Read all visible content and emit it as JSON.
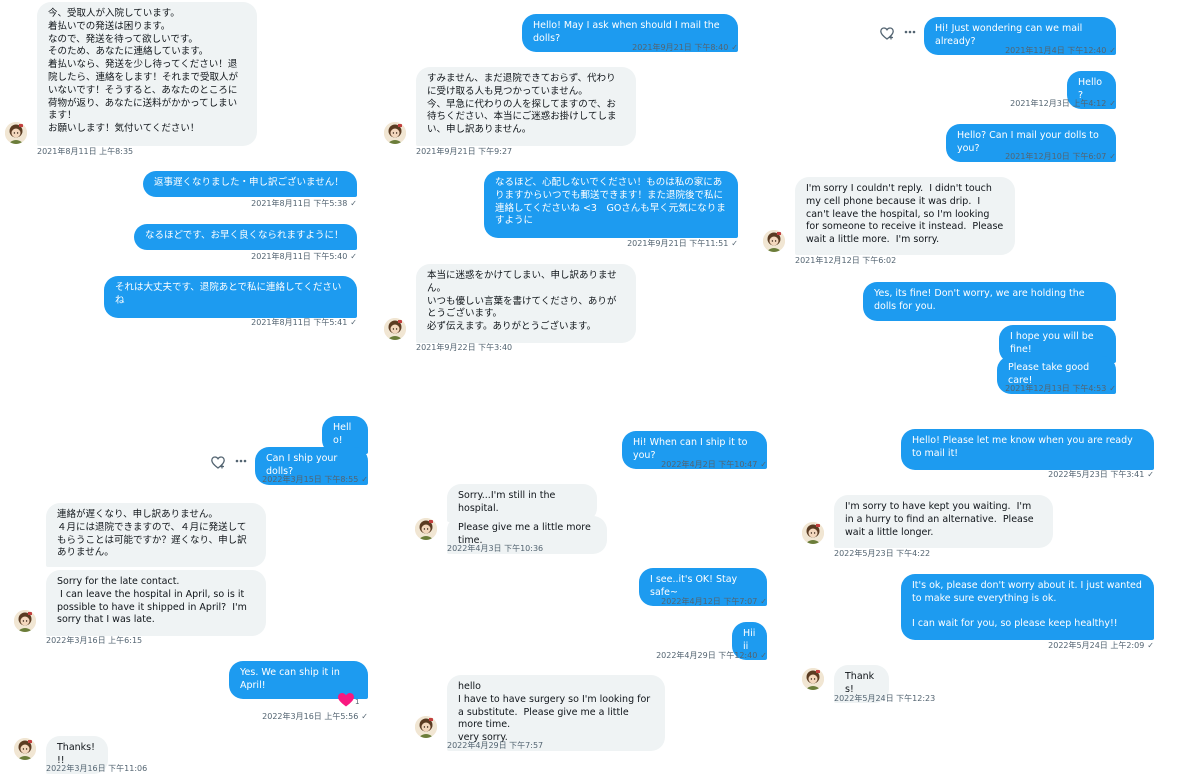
{
  "panels": [
    {
      "id": "p1",
      "messages": [
        {
          "side": "recv",
          "text": "今、受取人が入院しています。\n着払いでの発送は困ります。\nなので、発送を待って欲しいです。\nそのため、あなたに連絡しています。\n着払いなら、発送を少し待ってください！退院したら、連絡をします！それまで受取人がいないです！そうすると、あなたのところに荷物が返り、あなたに送料がかかってしまいます！\nお願いします！気付いてください！",
          "time": "2021年8月11日 上午8:35"
        },
        {
          "side": "sent",
          "text": "返事遅くなりました・申し訳ございません！",
          "time": "2021年8月11日 下午5:38"
        },
        {
          "side": "sent",
          "text": "なるほどです、お早く良くなられますように！",
          "time": "2021年8月11日 下午5:40"
        },
        {
          "side": "sent",
          "text": "それは大丈夫です、退院あとで私に連絡してください\nね",
          "time": "2021年8月11日 下午5:41"
        }
      ]
    },
    {
      "id": "p2",
      "messages": [
        {
          "side": "sent",
          "text": "Hello! May I ask when should I mail the dolls?",
          "time": "2021年9月21日 下午8:40"
        },
        {
          "side": "recv",
          "text": "すみません、まだ退院できておらず、代わりに受け取る人も見つかっていません。\n今、早急に代わりの人を探してますので、お待ちください、本当にご迷惑お掛けしてしまい、申し訳ありません。",
          "time": "2021年9月21日 下午9:27"
        },
        {
          "side": "sent",
          "text": "なるほど、心配しないでください！ものは私の家にありますからいつでも郵送できます！また退院後で私に連絡してくださいね <3　GOさんも早く元気になりますように",
          "time": "2021年9月21日 下午11:51"
        },
        {
          "side": "recv",
          "text": "本当に迷惑をかけてしまい、申し訳ありません。\nいつも優しい言葉を書けてくださり、ありがとうございます。\n必ず伝えます。ありがとうございます。",
          "time": "2021年9月22日 下午3:40"
        }
      ]
    },
    {
      "id": "p3",
      "messages": [
        {
          "side": "sent",
          "text": "Hi! Just wondering can we mail already?",
          "time": "2021年11月4日 下午12:40"
        },
        {
          "side": "sent",
          "text": "Hello?",
          "time": "2021年12月3日 上午4:12"
        },
        {
          "side": "sent",
          "text": "Hello? Can I mail your dolls to you?",
          "time": "2021年12月10日 下午6:07"
        },
        {
          "side": "recv",
          "text": "I'm sorry I couldn't reply.  I didn't touch my cell phone because it was drip.  I can't leave the hospital, so I'm looking for someone to receive it instead.  Please wait a little more.  I'm sorry.",
          "time": "2021年12月12日 下午6:02"
        },
        {
          "side": "sent",
          "text": "Yes, its fine! Don't worry, we are holding the dolls for you.",
          "time": ""
        },
        {
          "side": "sent",
          "text": "I hope you will be fine!",
          "time": ""
        },
        {
          "side": "sent",
          "text": "Please take good care!",
          "time": "2021年12月13日 下午4:53"
        }
      ]
    },
    {
      "id": "p4",
      "messages": [
        {
          "side": "sent",
          "text": "Hello!",
          "time": ""
        },
        {
          "side": "sent",
          "text": "Can I ship your dolls?",
          "time": "2022年3月15日 下午8:55"
        },
        {
          "side": "recv",
          "text": "連絡が遅くなり、申し訳ありません。\n４月には退院できますので、４月に発送してもらうことは可能ですか？遅くなり、申し訳ありません。",
          "time": ""
        },
        {
          "side": "recv",
          "text": "Sorry for the late contact.\n I can leave the hospital in April, so is it possible to have it shipped in April?  I'm sorry that I was late.",
          "time": "2022年3月16日 上午6:15"
        },
        {
          "side": "sent",
          "text": "Yes. We can ship it in April!",
          "time": "2022年3月16日 上午5:56"
        },
        {
          "side": "recv",
          "text": "Thanks!!!",
          "time": "2022年3月16日 下午11:06"
        }
      ],
      "reaction": {
        "emoji": "heart",
        "count": "1"
      }
    },
    {
      "id": "p5",
      "messages": [
        {
          "side": "sent",
          "text": "Hi! When can I ship it to you?",
          "time": "2022年4月2日 下午10:47"
        },
        {
          "side": "recv",
          "text": "Sorry...I'm still in the hospital.",
          "time": ""
        },
        {
          "side": "recv",
          "text": "Please give me a little more time.",
          "time": "2022年4月3日 下午10:36"
        },
        {
          "side": "sent",
          "text": "I see..it's OK! Stay safe~",
          "time": "2022年4月12日 下午7:07"
        },
        {
          "side": "sent",
          "text": "Hiiii",
          "time": "2022年4月29日 下午12:40"
        },
        {
          "side": "recv",
          "text": "hello\nI have to have surgery so I'm looking for a substitute.  Please give me a little more time.\nvery sorry.",
          "time": "2022年4月29日 下午7:57"
        }
      ]
    },
    {
      "id": "p6",
      "messages": [
        {
          "side": "sent",
          "text": "Hello! Please let me know when you are ready to mail it!",
          "time": "2022年5月23日 下午3:41"
        },
        {
          "side": "recv",
          "text": "I'm sorry to have kept you waiting.  I'm in a hurry to find an alternative.  Please wait a little longer.",
          "time": "2022年5月23日 下午4:22"
        },
        {
          "side": "sent",
          "text": "It's ok, please don't worry about it. I just wanted to make sure everything is ok.\n\nI can wait for you, so please keep healthy!!",
          "time": "2022年5月24日 上午2:09"
        },
        {
          "side": "recv",
          "text": "Thanks!",
          "time": "2022年5月24日 下午12:23"
        }
      ]
    }
  ],
  "icons": {
    "read": "check-icon",
    "react": "add-reaction-icon",
    "more": "more-icon",
    "reaction": "heart-icon"
  },
  "colors": {
    "sent": "#1d9bf0",
    "received": "#eff3f4",
    "timestamp": "#536471",
    "heart": "#f91880"
  }
}
